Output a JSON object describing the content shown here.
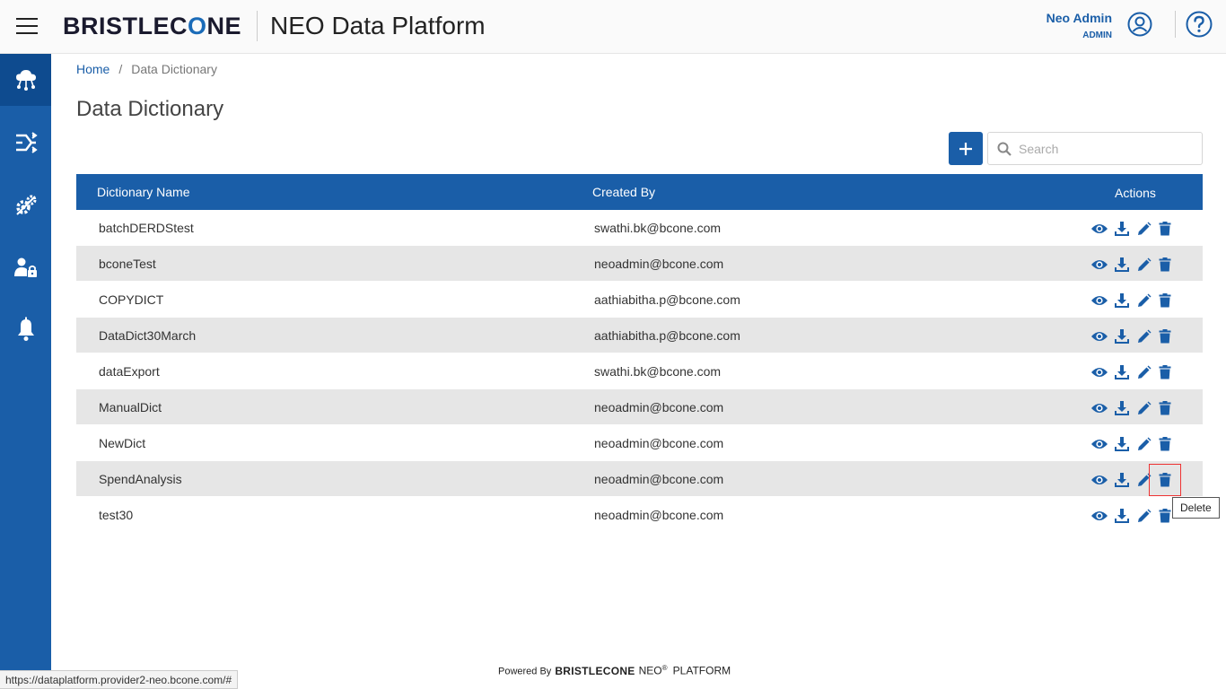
{
  "header": {
    "brand": "BRISTLECONE",
    "app_title": "NEO Data Platform",
    "user_name": "Neo Admin",
    "user_role": "ADMIN"
  },
  "sidebar": {
    "items": [
      {
        "name": "data-cloud",
        "icon": "cloud-network-icon",
        "active": true
      },
      {
        "name": "pipelines",
        "icon": "flow-arrows-icon",
        "active": false
      },
      {
        "name": "configuration",
        "icon": "gears-icon",
        "active": false
      },
      {
        "name": "user-security",
        "icon": "user-lock-icon",
        "active": false
      },
      {
        "name": "notifications",
        "icon": "bell-icon",
        "active": false
      }
    ]
  },
  "breadcrumb": {
    "home": "Home",
    "separator": "/",
    "current": "Data Dictionary"
  },
  "page_title": "Data Dictionary",
  "search": {
    "placeholder": "Search",
    "value": ""
  },
  "table": {
    "headers": {
      "name": "Dictionary Name",
      "created_by": "Created By",
      "actions": "Actions"
    },
    "rows": [
      {
        "name": "batchDERDStest",
        "created_by": "swathi.bk@bcone.com"
      },
      {
        "name": "bconeTest",
        "created_by": "neoadmin@bcone.com"
      },
      {
        "name": "COPYDICT",
        "created_by": "aathiabitha.p@bcone.com"
      },
      {
        "name": "DataDict30March",
        "created_by": "aathiabitha.p@bcone.com"
      },
      {
        "name": "dataExport",
        "created_by": "swathi.bk@bcone.com"
      },
      {
        "name": "ManualDict",
        "created_by": "neoadmin@bcone.com"
      },
      {
        "name": "NewDict",
        "created_by": "neoadmin@bcone.com"
      },
      {
        "name": "SpendAnalysis",
        "created_by": "neoadmin@bcone.com"
      },
      {
        "name": "test30",
        "created_by": "neoadmin@bcone.com"
      }
    ]
  },
  "tooltip": "Delete",
  "footer": {
    "powered_by": "Powered By",
    "brand": "BRISTLECONE",
    "neo": "NEO",
    "registered": "®",
    "platform": "PLATFORM"
  },
  "status_url": "https://dataplatform.provider2-neo.bcone.com/#",
  "colors": {
    "primary": "#1a5ea8",
    "sidebar_active": "#0e4b8f",
    "row_alt": "#e6e6e6",
    "focus_outline": "#e33333"
  }
}
